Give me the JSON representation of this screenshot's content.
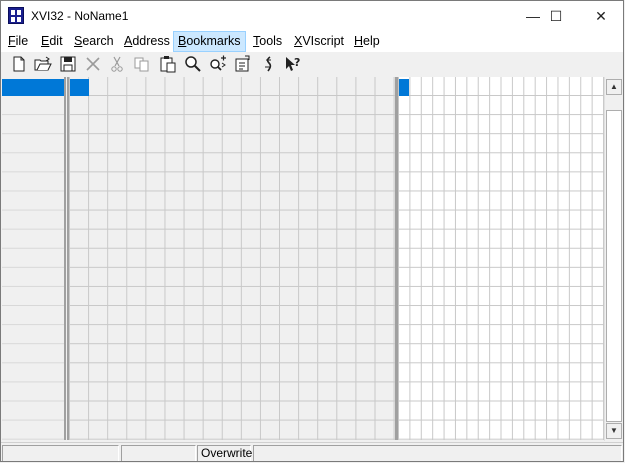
{
  "window": {
    "title": "XVI32 - NoName1",
    "controls": {
      "minimize": "—",
      "maximize": "☐",
      "close": "✕"
    }
  },
  "menu": {
    "items": [
      {
        "label": "File",
        "accel": "F",
        "rest": "ile"
      },
      {
        "label": "Edit",
        "accel": "E",
        "rest": "dit"
      },
      {
        "label": "Search",
        "accel": "S",
        "rest": "earch"
      },
      {
        "label": "Address",
        "accel": "A",
        "rest": "ddress"
      },
      {
        "label": "Bookmarks",
        "accel": "B",
        "rest": "ookmarks"
      },
      {
        "label": "Tools",
        "accel": "T",
        "rest": "ools"
      },
      {
        "label": "XVIscript",
        "accel": "X",
        "rest": "VIscript"
      },
      {
        "label": "Help",
        "accel": "H",
        "rest": "elp"
      }
    ],
    "active": "Bookmarks"
  },
  "toolbar": {
    "tools": [
      "new-file-icon",
      "open-folder-icon",
      "save-icon",
      "delete-icon",
      "cut-icon",
      "copy-icon",
      "paste-icon",
      "find-icon",
      "find-next-icon",
      "properties-icon",
      "script-icon",
      "help-pointer-icon"
    ]
  },
  "status": {
    "panel1": "",
    "panel2": "",
    "panel3": "Overwrite"
  },
  "colors": {
    "selection": "#0078d7",
    "menu_active": "#cce8ff",
    "app_icon": "#1a1f8f"
  }
}
